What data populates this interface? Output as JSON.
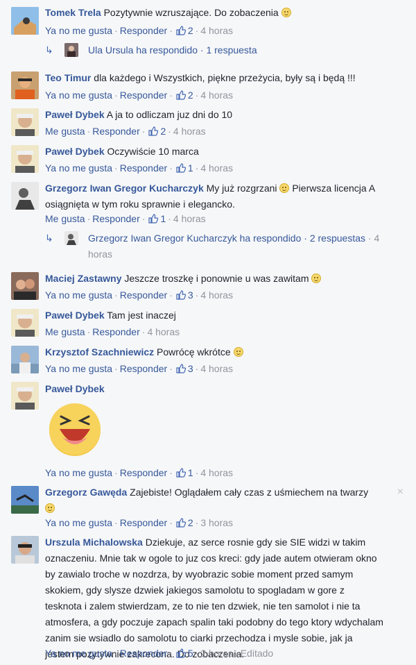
{
  "ui": {
    "reply": "Responder",
    "sep": "·",
    "like": "Ya no me gusta",
    "like_alt": "Me gusta"
  },
  "comments": [
    {
      "author": "Tomek Trela",
      "text": "Pozytywnie wzruszające. Do zobaczenia",
      "like_label": "Ya no me gusta",
      "likes": "2",
      "time": "4 horas",
      "reply": {
        "author": "Ula Ursula",
        "text": "ha respondido",
        "count": "1 respuesta"
      }
    },
    {
      "author": "Teo Timur",
      "text": "dla każdego i Wszystkich, piękne przeżycia, były są i będą !!!",
      "like_label": "Ya no me gusta",
      "likes": "2",
      "time": "4 horas"
    },
    {
      "author": "Paweł Dybek",
      "text": "A ja to odliczam juz dni do 10",
      "like_label": "Me gusta",
      "likes": "2",
      "time": "4 horas"
    },
    {
      "author": "Paweł Dybek",
      "text": "Oczywiście 10 marca",
      "like_label": "Ya no me gusta",
      "likes": "1",
      "time": "4 horas"
    },
    {
      "author": "Grzegorz Iwan Gregor Kucharczyk",
      "text_line1": "My już rozgrzani",
      "text_line1b": "Pierwsza licencja A",
      "text_line2": "osiągnięta w tym roku sprawnie i elegancko.",
      "like_label": "Me gusta",
      "likes": "1",
      "time": "4 horas",
      "reply": {
        "author": "Grzegorz Iwan Gregor Kucharczyk",
        "text": "ha respondido",
        "count": "2 respuestas",
        "time_a": "4",
        "time_b": "horas"
      }
    },
    {
      "author": "Maciej Zastawny",
      "text": "Jeszcze troszkę i ponownie u was zawitam",
      "like_label": "Ya no me gusta",
      "likes": "3",
      "time": "4 horas"
    },
    {
      "author": "Paweł Dybek",
      "text": "Tam jest inaczej",
      "like_label": "Me gusta",
      "time": "4 horas"
    },
    {
      "author": "Krzysztof Szachniewicz",
      "text": "Powrócę wkrótce",
      "like_label": "Ya no me gusta",
      "likes": "3",
      "time": "4 horas"
    },
    {
      "author": "Paweł Dybek",
      "like_label": "Ya no me gusta",
      "likes": "1",
      "time": "4 horas"
    },
    {
      "author": "Grzegorz Gawęda",
      "text": "Zajebiste! Oglądałem cały czas z uśmiechem na twarzy",
      "like_label": "Ya no me gusta",
      "likes": "2",
      "time": "3 horas",
      "close": "×"
    },
    {
      "author": "Urszula Michalowska",
      "lines": [
        "Dziekuje, az serce rosnie gdy sie SIE widzi w takim",
        "oznaczeniu. Mnie tak w ogole to juz cos kreci: gdy jade autem otwieram okno",
        "by zawialo troche w nozdrza, by wyobrazic sobie moment przed samym",
        "skokiem, gdy slysze dzwiek jakiegos samolotu to spogladam w gore z",
        "tesknota i zalem stwierdzam, ze to nie ten dzwiek, nie ten samolot i nie ta",
        "atmosfera, a gdy poczuje zapach spalin taki podobny do tego ktory wdychalam",
        "zanim sie wsiadlo do samolotu to ciarki przechodza i mysle sobie, jak ja",
        "jestem pozytywnie zakrecona. Do zobaczenia."
      ],
      "like_label": "Ya no me gusta",
      "likes": "5",
      "time": "2 horas",
      "edited": "Editado"
    }
  ],
  "colors": {
    "background": "#f6f7f9",
    "link": "#365899",
    "meta": "#90949c",
    "text": "#1d2129"
  }
}
